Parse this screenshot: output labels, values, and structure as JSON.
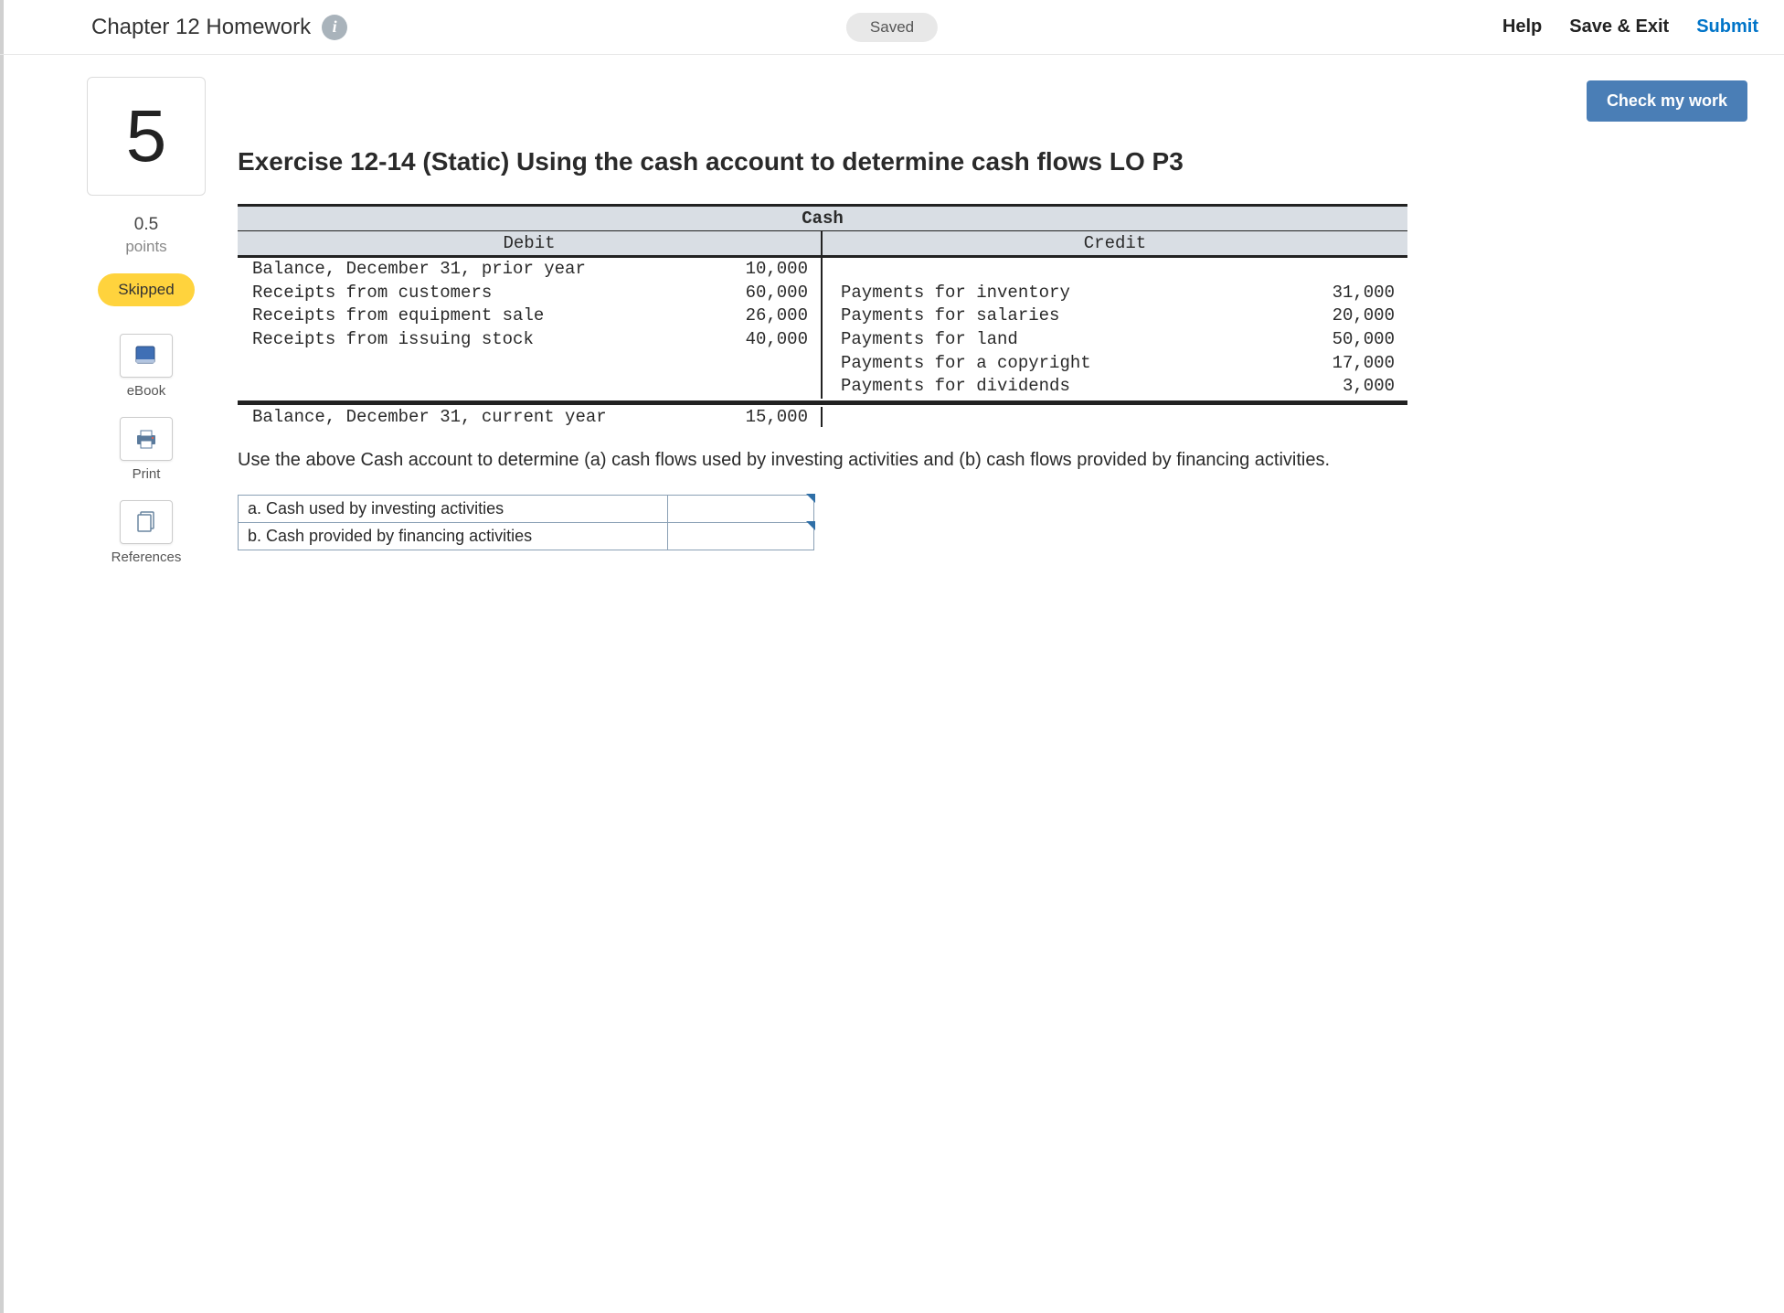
{
  "header": {
    "title": "Chapter 12 Homework",
    "saved": "Saved",
    "help": "Help",
    "save_exit": "Save & Exit",
    "submit": "Submit"
  },
  "sidebar": {
    "question_number": "5",
    "points_value": "0.5",
    "points_word": "points",
    "skipped": "Skipped",
    "items": [
      {
        "label": "eBook"
      },
      {
        "label": "Print"
      },
      {
        "label": "References"
      }
    ]
  },
  "main": {
    "check_work": "Check my work",
    "title": "Exercise 12-14 (Static) Using the cash account to determine cash flows LO P3",
    "taccount": {
      "title": "Cash",
      "debit_header": "Debit",
      "credit_header": "Credit",
      "debits": [
        {
          "desc": "Balance, December 31, prior year",
          "amt": "10,000"
        },
        {
          "desc": "Receipts from customers",
          "amt": "60,000"
        },
        {
          "desc": "Receipts from equipment sale",
          "amt": "26,000"
        },
        {
          "desc": "Receipts from issuing stock",
          "amt": "40,000"
        }
      ],
      "credits": [
        {
          "desc": "Payments for inventory",
          "amt": "31,000"
        },
        {
          "desc": "Payments for salaries",
          "amt": "20,000"
        },
        {
          "desc": "Payments for land",
          "amt": "50,000"
        },
        {
          "desc": "Payments for a copyright",
          "amt": "17,000"
        },
        {
          "desc": "Payments for dividends",
          "amt": "3,000"
        }
      ],
      "ending_balance": {
        "desc": "Balance, December 31, current year",
        "amt": "15,000"
      }
    },
    "instructions": "Use the above Cash account to determine (a) cash flows used by investing activities and (b) cash flows provided by financing activities.",
    "answers": [
      {
        "label": "a. Cash used by investing activities"
      },
      {
        "label": "b. Cash provided by financing activities"
      }
    ]
  }
}
